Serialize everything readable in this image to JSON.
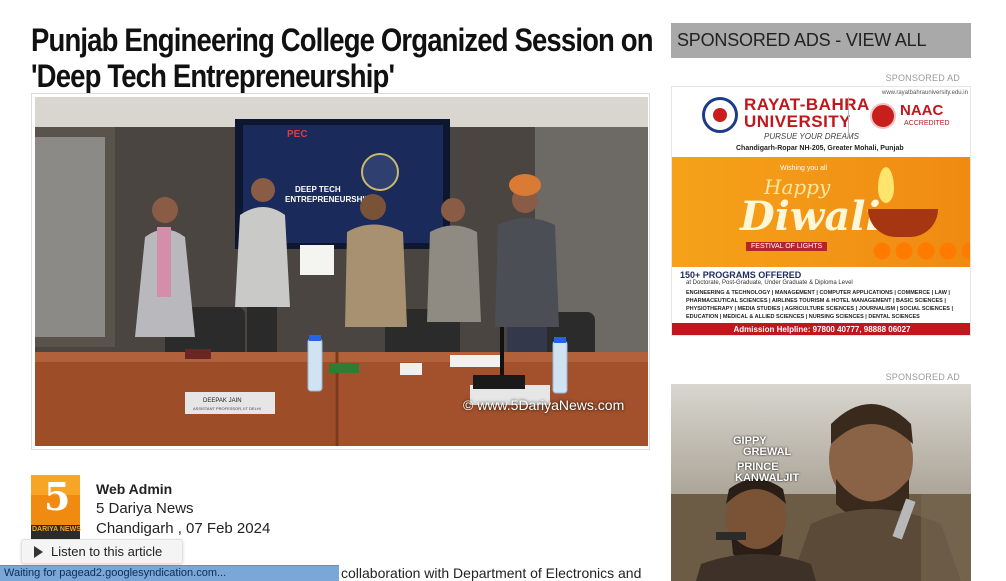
{
  "article": {
    "title": "Punjab Engineering College Organized Session on 'Deep Tech Entrepreneurship'",
    "image_watermark": "© www.5DariyaNews.com"
  },
  "author": {
    "logo_digit": "5",
    "logo_text": "DARIYA NEWS",
    "name": "Web Admin",
    "organization": "5 Dariya News",
    "dateline": "Chandigarh , 07 Feb 2024"
  },
  "listen": {
    "label": "Listen to this article"
  },
  "status_bar": {
    "text": "Waiting for pagead2.googlesyndication.com..."
  },
  "body": {
    "snippet": "collaboration with Department of Electronics and"
  },
  "sidebar": {
    "header": "SPONSORED ADS - VIEW ALL",
    "sponsored_label_1": "SPONSORED AD",
    "sponsored_label_2": "SPONSORED AD"
  },
  "ad1": {
    "url": "www.rayatbahrauniversity.edu.in",
    "university_line1": "RAYAT-BAHRA",
    "university_line2": "UNIVERSITY",
    "tagline": "PURSUE YOUR DREAMS",
    "naac": "NAAC",
    "naac_sub": "ACCREDITED",
    "address": "Chandigarh-Ropar NH-205, Greater Mohali, Punjab",
    "wishing": "Wishing you all",
    "happy": "Happy",
    "diwali": "Diwali",
    "festival": "FESTIVAL OF LIGHTS",
    "programs": "150+ PROGRAMS OFFERED",
    "levels": "at Doctorate, Post-Graduate, Under Graduate & Diploma Level",
    "courses": "ENGINEERING & TECHNOLOGY | MANAGEMENT | COMPUTER APPLICATIONS | COMMERCE | LAW | PHARMACEUTICAL SCIENCES | AIRLINES TOURISM & HOTEL MANAGEMENT | BASIC SCIENCES | PHYSIOTHERAPY | MEDIA STUDIES | AGRICULTURE SCIENCES | JOURNALISM | SOCIAL SCIENCES | EDUCATION | MEDICAL & ALLIED SCIENCES | NURSING SCIENCES | DENTAL SCIENCES",
    "helpline": "Admission Helpline: 97800 40777, 98888 06027"
  },
  "ad2": {
    "actor1_first": "GIPPY",
    "actor1_last": "GREWAL",
    "actor2_first": "PRINCE",
    "actor2_last": "KANWALJIT"
  },
  "colors": {
    "sidebar_header_bg": "#a9a9a9",
    "status_bar_bg": "#7aa7d8",
    "ad1_brand_red": "#c0171c",
    "ad1_orange": "#f5a21a"
  }
}
